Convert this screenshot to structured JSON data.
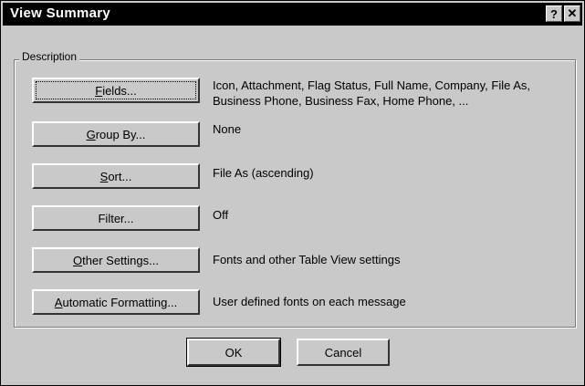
{
  "window": {
    "title": "View Summary",
    "help_glyph": "?",
    "close_glyph": "✕"
  },
  "description": {
    "legend": "Description",
    "rows": [
      {
        "button": "Fields...",
        "text": "Icon, Attachment, Flag Status, Full Name, Company, File As, Business Phone, Business Fax, Home Phone, ..."
      },
      {
        "button": "Group By...",
        "text": "None"
      },
      {
        "button": "Sort...",
        "text": "File As (ascending)"
      },
      {
        "button": "Filter...",
        "text": "Off"
      },
      {
        "button": "Other Settings...",
        "text": "Fonts and other Table View settings"
      },
      {
        "button": "Automatic Formatting...",
        "text": "User defined fonts on each message"
      }
    ]
  },
  "footer": {
    "ok_label": "OK",
    "cancel_label": "Cancel"
  }
}
